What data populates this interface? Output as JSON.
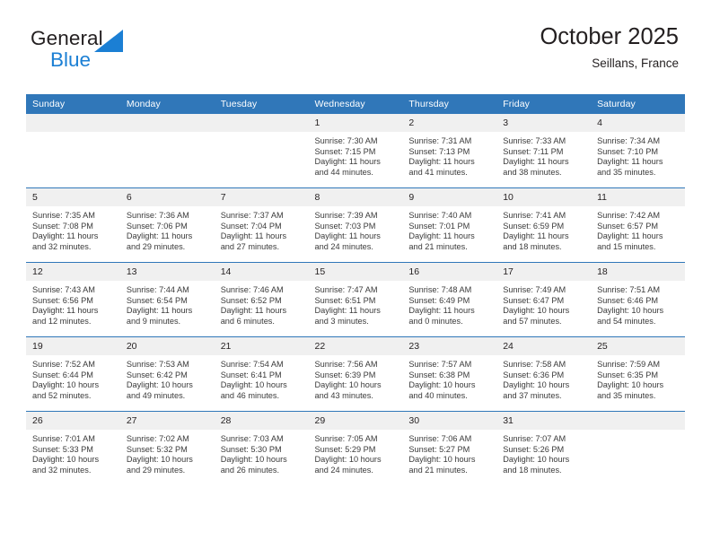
{
  "brand": {
    "name_part1": "General",
    "name_part2": "Blue",
    "triangle_color": "#1b7fd4",
    "text_color": "#231f20"
  },
  "header": {
    "title": "October 2025",
    "subtitle": "Seillans, France",
    "accent_color": "#3077b9"
  },
  "calendar": {
    "weekday_headers": [
      "Sunday",
      "Monday",
      "Tuesday",
      "Wednesday",
      "Thursday",
      "Friday",
      "Saturday"
    ],
    "weeks": [
      [
        {
          "day": "",
          "sunrise": "",
          "sunset": "",
          "daylight_line1": "",
          "daylight_line2": "",
          "empty": true
        },
        {
          "day": "",
          "sunrise": "",
          "sunset": "",
          "daylight_line1": "",
          "daylight_line2": "",
          "empty": true
        },
        {
          "day": "",
          "sunrise": "",
          "sunset": "",
          "daylight_line1": "",
          "daylight_line2": "",
          "empty": true
        },
        {
          "day": "1",
          "sunrise": "Sunrise: 7:30 AM",
          "sunset": "Sunset: 7:15 PM",
          "daylight_line1": "Daylight: 11 hours",
          "daylight_line2": "and 44 minutes."
        },
        {
          "day": "2",
          "sunrise": "Sunrise: 7:31 AM",
          "sunset": "Sunset: 7:13 PM",
          "daylight_line1": "Daylight: 11 hours",
          "daylight_line2": "and 41 minutes."
        },
        {
          "day": "3",
          "sunrise": "Sunrise: 7:33 AM",
          "sunset": "Sunset: 7:11 PM",
          "daylight_line1": "Daylight: 11 hours",
          "daylight_line2": "and 38 minutes."
        },
        {
          "day": "4",
          "sunrise": "Sunrise: 7:34 AM",
          "sunset": "Sunset: 7:10 PM",
          "daylight_line1": "Daylight: 11 hours",
          "daylight_line2": "and 35 minutes."
        }
      ],
      [
        {
          "day": "5",
          "sunrise": "Sunrise: 7:35 AM",
          "sunset": "Sunset: 7:08 PM",
          "daylight_line1": "Daylight: 11 hours",
          "daylight_line2": "and 32 minutes."
        },
        {
          "day": "6",
          "sunrise": "Sunrise: 7:36 AM",
          "sunset": "Sunset: 7:06 PM",
          "daylight_line1": "Daylight: 11 hours",
          "daylight_line2": "and 29 minutes."
        },
        {
          "day": "7",
          "sunrise": "Sunrise: 7:37 AM",
          "sunset": "Sunset: 7:04 PM",
          "daylight_line1": "Daylight: 11 hours",
          "daylight_line2": "and 27 minutes."
        },
        {
          "day": "8",
          "sunrise": "Sunrise: 7:39 AM",
          "sunset": "Sunset: 7:03 PM",
          "daylight_line1": "Daylight: 11 hours",
          "daylight_line2": "and 24 minutes."
        },
        {
          "day": "9",
          "sunrise": "Sunrise: 7:40 AM",
          "sunset": "Sunset: 7:01 PM",
          "daylight_line1": "Daylight: 11 hours",
          "daylight_line2": "and 21 minutes."
        },
        {
          "day": "10",
          "sunrise": "Sunrise: 7:41 AM",
          "sunset": "Sunset: 6:59 PM",
          "daylight_line1": "Daylight: 11 hours",
          "daylight_line2": "and 18 minutes."
        },
        {
          "day": "11",
          "sunrise": "Sunrise: 7:42 AM",
          "sunset": "Sunset: 6:57 PM",
          "daylight_line1": "Daylight: 11 hours",
          "daylight_line2": "and 15 minutes."
        }
      ],
      [
        {
          "day": "12",
          "sunrise": "Sunrise: 7:43 AM",
          "sunset": "Sunset: 6:56 PM",
          "daylight_line1": "Daylight: 11 hours",
          "daylight_line2": "and 12 minutes."
        },
        {
          "day": "13",
          "sunrise": "Sunrise: 7:44 AM",
          "sunset": "Sunset: 6:54 PM",
          "daylight_line1": "Daylight: 11 hours",
          "daylight_line2": "and 9 minutes."
        },
        {
          "day": "14",
          "sunrise": "Sunrise: 7:46 AM",
          "sunset": "Sunset: 6:52 PM",
          "daylight_line1": "Daylight: 11 hours",
          "daylight_line2": "and 6 minutes."
        },
        {
          "day": "15",
          "sunrise": "Sunrise: 7:47 AM",
          "sunset": "Sunset: 6:51 PM",
          "daylight_line1": "Daylight: 11 hours",
          "daylight_line2": "and 3 minutes."
        },
        {
          "day": "16",
          "sunrise": "Sunrise: 7:48 AM",
          "sunset": "Sunset: 6:49 PM",
          "daylight_line1": "Daylight: 11 hours",
          "daylight_line2": "and 0 minutes."
        },
        {
          "day": "17",
          "sunrise": "Sunrise: 7:49 AM",
          "sunset": "Sunset: 6:47 PM",
          "daylight_line1": "Daylight: 10 hours",
          "daylight_line2": "and 57 minutes."
        },
        {
          "day": "18",
          "sunrise": "Sunrise: 7:51 AM",
          "sunset": "Sunset: 6:46 PM",
          "daylight_line1": "Daylight: 10 hours",
          "daylight_line2": "and 54 minutes."
        }
      ],
      [
        {
          "day": "19",
          "sunrise": "Sunrise: 7:52 AM",
          "sunset": "Sunset: 6:44 PM",
          "daylight_line1": "Daylight: 10 hours",
          "daylight_line2": "and 52 minutes."
        },
        {
          "day": "20",
          "sunrise": "Sunrise: 7:53 AM",
          "sunset": "Sunset: 6:42 PM",
          "daylight_line1": "Daylight: 10 hours",
          "daylight_line2": "and 49 minutes."
        },
        {
          "day": "21",
          "sunrise": "Sunrise: 7:54 AM",
          "sunset": "Sunset: 6:41 PM",
          "daylight_line1": "Daylight: 10 hours",
          "daylight_line2": "and 46 minutes."
        },
        {
          "day": "22",
          "sunrise": "Sunrise: 7:56 AM",
          "sunset": "Sunset: 6:39 PM",
          "daylight_line1": "Daylight: 10 hours",
          "daylight_line2": "and 43 minutes."
        },
        {
          "day": "23",
          "sunrise": "Sunrise: 7:57 AM",
          "sunset": "Sunset: 6:38 PM",
          "daylight_line1": "Daylight: 10 hours",
          "daylight_line2": "and 40 minutes."
        },
        {
          "day": "24",
          "sunrise": "Sunrise: 7:58 AM",
          "sunset": "Sunset: 6:36 PM",
          "daylight_line1": "Daylight: 10 hours",
          "daylight_line2": "and 37 minutes."
        },
        {
          "day": "25",
          "sunrise": "Sunrise: 7:59 AM",
          "sunset": "Sunset: 6:35 PM",
          "daylight_line1": "Daylight: 10 hours",
          "daylight_line2": "and 35 minutes."
        }
      ],
      [
        {
          "day": "26",
          "sunrise": "Sunrise: 7:01 AM",
          "sunset": "Sunset: 5:33 PM",
          "daylight_line1": "Daylight: 10 hours",
          "daylight_line2": "and 32 minutes."
        },
        {
          "day": "27",
          "sunrise": "Sunrise: 7:02 AM",
          "sunset": "Sunset: 5:32 PM",
          "daylight_line1": "Daylight: 10 hours",
          "daylight_line2": "and 29 minutes."
        },
        {
          "day": "28",
          "sunrise": "Sunrise: 7:03 AM",
          "sunset": "Sunset: 5:30 PM",
          "daylight_line1": "Daylight: 10 hours",
          "daylight_line2": "and 26 minutes."
        },
        {
          "day": "29",
          "sunrise": "Sunrise: 7:05 AM",
          "sunset": "Sunset: 5:29 PM",
          "daylight_line1": "Daylight: 10 hours",
          "daylight_line2": "and 24 minutes."
        },
        {
          "day": "30",
          "sunrise": "Sunrise: 7:06 AM",
          "sunset": "Sunset: 5:27 PM",
          "daylight_line1": "Daylight: 10 hours",
          "daylight_line2": "and 21 minutes."
        },
        {
          "day": "31",
          "sunrise": "Sunrise: 7:07 AM",
          "sunset": "Sunset: 5:26 PM",
          "daylight_line1": "Daylight: 10 hours",
          "daylight_line2": "and 18 minutes."
        },
        {
          "day": "",
          "sunrise": "",
          "sunset": "",
          "daylight_line1": "",
          "daylight_line2": "",
          "empty": true
        }
      ]
    ]
  }
}
